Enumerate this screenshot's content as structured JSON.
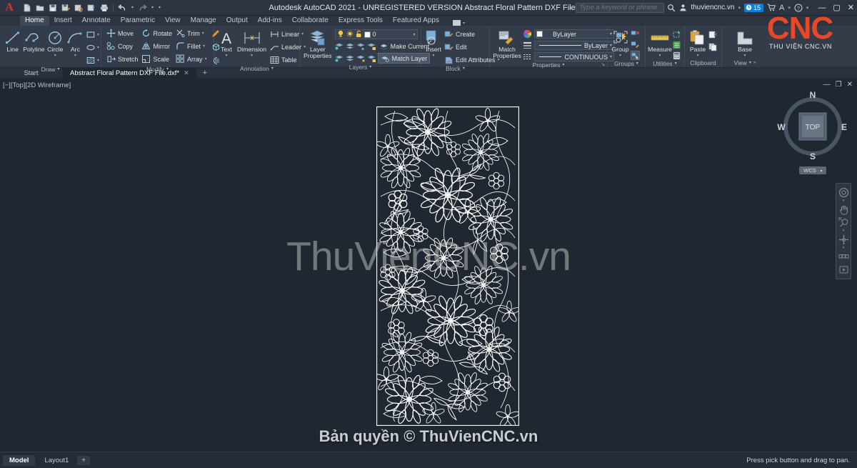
{
  "titlebar": {
    "app_icon": "autocad-a-icon",
    "title": "Autodesk AutoCAD 2021 - UNREGISTERED VERSION    Abstract Floral Pattern DXF File.dxf",
    "quick_access": [
      {
        "name": "new-file",
        "glyph": "▭"
      },
      {
        "name": "open-file",
        "glyph": "▭"
      },
      {
        "name": "save-file",
        "glyph": "▤"
      },
      {
        "name": "save-as",
        "glyph": "▤"
      },
      {
        "name": "plot-preview",
        "glyph": "▤"
      },
      {
        "name": "publish",
        "glyph": "▣"
      },
      {
        "name": "print",
        "glyph": "▰"
      },
      {
        "name": "undo",
        "glyph": "↰"
      },
      {
        "name": "redo",
        "glyph": "↱"
      }
    ],
    "search": {
      "placeholder": "Type a keyword or phrase",
      "value": ""
    },
    "user": "thuviencnc.vn",
    "clock_badge": "15",
    "window_buttons": [
      "minimize",
      "maximize",
      "close"
    ]
  },
  "logo": {
    "text_top": "CNC",
    "text_bottom": "THU VIỆN CNC.VN",
    "accent": "#e8482a"
  },
  "ribbon": {
    "tabs": [
      {
        "label": "Home",
        "active": true
      },
      {
        "label": "Insert",
        "active": false
      },
      {
        "label": "Annotate",
        "active": false
      },
      {
        "label": "Parametric",
        "active": false
      },
      {
        "label": "View",
        "active": false
      },
      {
        "label": "Manage",
        "active": false
      },
      {
        "label": "Output",
        "active": false
      },
      {
        "label": "Add-ins",
        "active": false
      },
      {
        "label": "Collaborate",
        "active": false
      },
      {
        "label": "Express Tools",
        "active": false
      },
      {
        "label": "Featured Apps",
        "active": false
      }
    ],
    "panels": {
      "draw": {
        "title": "Draw",
        "buttons": [
          {
            "label": "Line",
            "icon": "line-icon"
          },
          {
            "label": "Polyline",
            "icon": "polyline-icon"
          },
          {
            "label": "Circle",
            "icon": "circle-icon"
          },
          {
            "label": "Arc",
            "icon": "arc-icon"
          }
        ],
        "small_icons": [
          "rectangle-icon",
          "ellipse-icon",
          "hatch-icon"
        ]
      },
      "modify": {
        "title": "Modify",
        "items": [
          {
            "label": "Move",
            "icon": "move-icon"
          },
          {
            "label": "Rotate",
            "icon": "rotate-icon"
          },
          {
            "label": "Trim",
            "icon": "trim-icon"
          },
          {
            "label": "Copy",
            "icon": "copy-icon"
          },
          {
            "label": "Mirror",
            "icon": "mirror-icon"
          },
          {
            "label": "Fillet",
            "icon": "fillet-icon"
          },
          {
            "label": "Stretch",
            "icon": "stretch-icon"
          },
          {
            "label": "Scale",
            "icon": "scale-icon"
          },
          {
            "label": "Array",
            "icon": "array-icon"
          }
        ],
        "extra_icons": [
          "erase-icon",
          "3d-rotate-icon",
          "explode-icon"
        ]
      },
      "annotation": {
        "title": "Annotation",
        "big": [
          {
            "label": "Text",
            "icon": "text-icon"
          },
          {
            "label": "Dimension",
            "icon": "dimension-icon"
          }
        ],
        "small": [
          {
            "label": "Linear",
            "icon": "linear-dim-icon"
          },
          {
            "label": "Leader",
            "icon": "leader-icon"
          },
          {
            "label": "Table",
            "icon": "table-icon"
          }
        ]
      },
      "layers": {
        "title": "Layers",
        "big": {
          "label": "Layer",
          "label2": "Properties",
          "icon": "layer-properties-icon"
        },
        "current_layer": "0",
        "toggles": [
          "lightbulb-on-icon",
          "sun-icon",
          "unlock-icon"
        ],
        "actions": [
          {
            "label": "Make Current",
            "icon": "make-current-icon"
          },
          {
            "label": "Match Layer",
            "icon": "match-layer-icon",
            "highlighted": true
          }
        ]
      },
      "block": {
        "title": "Block",
        "big": {
          "label": "Insert",
          "icon": "insert-block-icon"
        },
        "items": [
          {
            "label": "Create",
            "icon": "create-block-icon"
          },
          {
            "label": "Edit",
            "icon": "edit-block-icon"
          },
          {
            "label": "Edit Attributes",
            "icon": "edit-attributes-icon"
          }
        ]
      },
      "properties": {
        "title": "Properties",
        "big": {
          "label": "Match",
          "label2": "Properties",
          "icon": "match-properties-icon"
        },
        "color": "ByLayer",
        "lineweight": "ByLayer",
        "linetype": "CONTINUOUS",
        "color_swatch": "#ffffff"
      },
      "groups": {
        "title": "Groups",
        "big": {
          "label": "Group",
          "icon": "group-icon"
        },
        "small_icons": [
          "ungroup-icon",
          "group-edit-icon",
          "group-select-icon"
        ]
      },
      "utilities": {
        "title": "Utilities",
        "big": {
          "label": "Measure",
          "icon": "measure-icon"
        },
        "small_icons": [
          "quick-select-icon",
          "quick-calc-icon",
          "calculator-icon"
        ]
      },
      "clipboard": {
        "title": "Clipboard",
        "big": {
          "label": "Paste",
          "icon": "paste-icon"
        },
        "small_icons": [
          "cut-icon",
          "copy-clip-icon"
        ]
      },
      "view": {
        "title": "View",
        "big": {
          "label": "Base",
          "icon": "base-view-icon"
        }
      }
    }
  },
  "filetabs": {
    "start": "Start",
    "tabs": [
      {
        "label": "Abstract Floral Pattern DXF File.dxf*",
        "active": true,
        "closeable": true
      }
    ],
    "plus": "+"
  },
  "viewport": {
    "label": "[−][Top][2D Wireframe]",
    "window_buttons": [
      "minimize",
      "restore",
      "close"
    ],
    "viewcube": {
      "face": "TOP",
      "north": "N",
      "south": "S",
      "east": "E",
      "west": "W",
      "coord_system": "WCS"
    },
    "navbar_icons": [
      "steering-wheel-icon",
      "pan-hand-icon",
      "zoom-icon",
      "orbit-icon",
      "showmotion-icon"
    ],
    "drawing_title": "Abstract Floral Pattern",
    "line_color": "#ffffff",
    "background": "#1f2730"
  },
  "watermarks": {
    "center": "ThuVienCNC.vn",
    "bottom": "Bản quyền © ThuVienCNC.vn"
  },
  "statusbar": {
    "model_tab": "Model",
    "layout_tabs": [
      "Layout1"
    ],
    "plus": "+",
    "message": "Press pick button and drag to pan."
  }
}
